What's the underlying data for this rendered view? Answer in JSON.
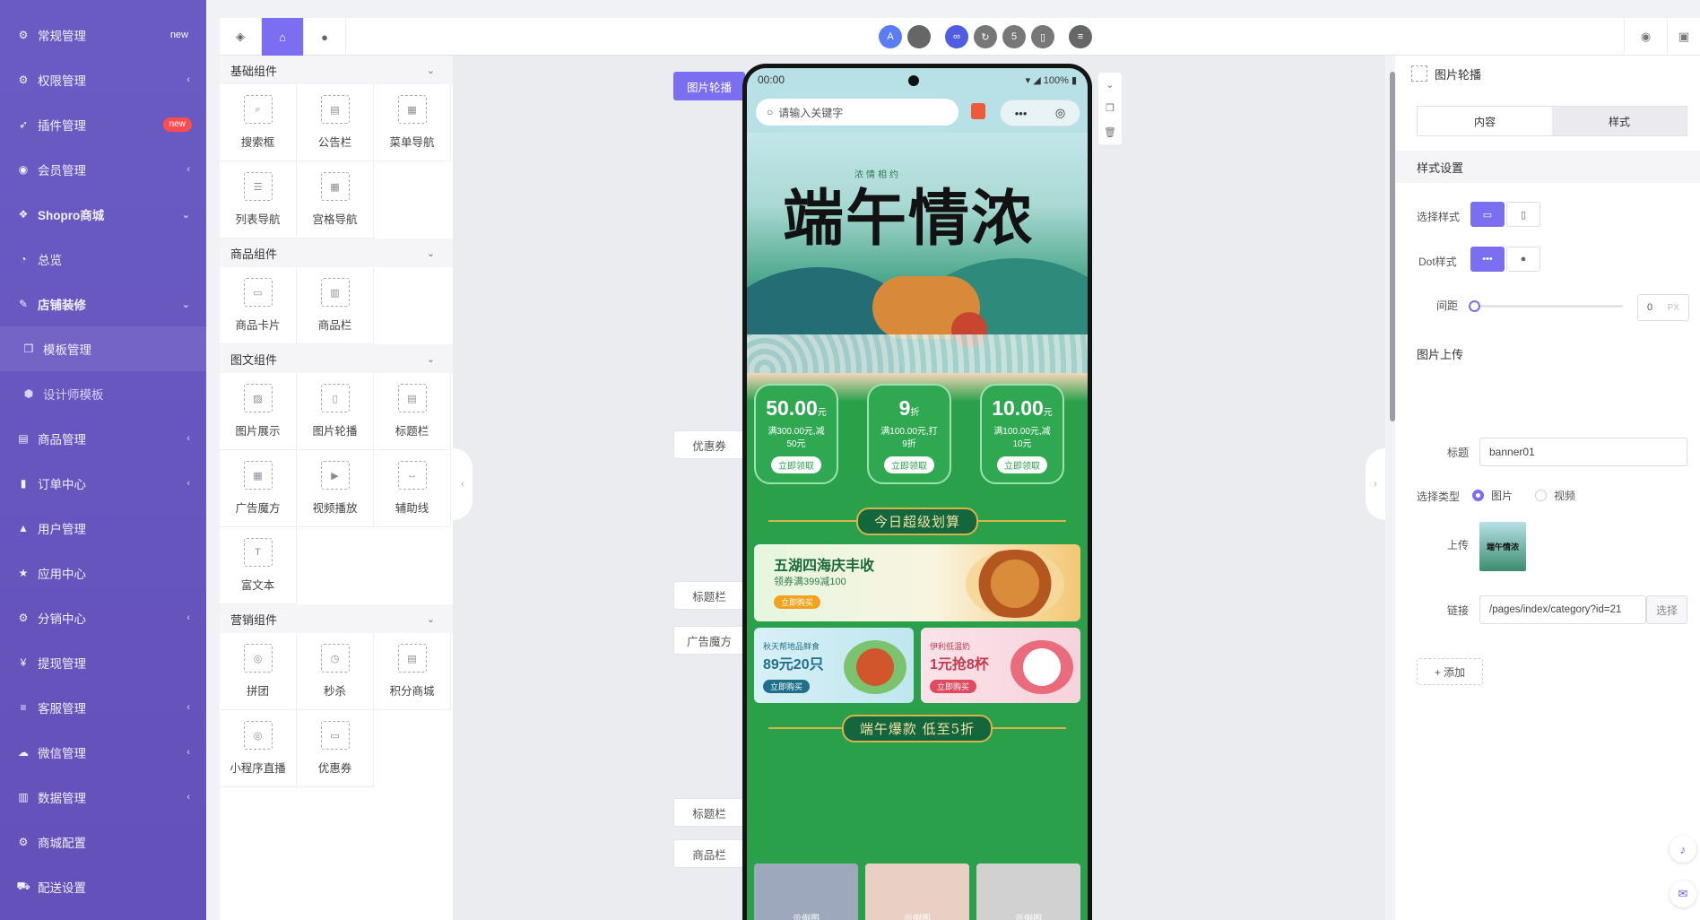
{
  "colors": {
    "accent": "#7b6ef0",
    "nav_bg": "#6451b9",
    "phone_green": "#2aa04a"
  },
  "sidenav": [
    {
      "label": "常规管理",
      "icon": "gear-icon",
      "tag": "new"
    },
    {
      "label": "权限管理",
      "icon": "users-gear-icon",
      "arrow": "‹"
    },
    {
      "label": "插件管理",
      "icon": "rocket-icon",
      "badge": "new"
    },
    {
      "label": "会员管理",
      "icon": "user-circle-icon",
      "arrow": "‹"
    },
    {
      "label": "Shopro商城",
      "icon": "dropbox-icon",
      "arrow": "⌄"
    },
    {
      "label": "总览",
      "icon": "pie-chart-icon"
    },
    {
      "label": "店铺装修",
      "icon": "brush-icon",
      "arrow": "⌄"
    },
    {
      "label": "模板管理",
      "icon": "cubes-icon"
    },
    {
      "label": "设计师模板",
      "icon": "cube-icon"
    },
    {
      "label": "商品管理",
      "icon": "product-icon",
      "arrow": "‹"
    },
    {
      "label": "订单中心",
      "icon": "file-icon",
      "arrow": "‹"
    },
    {
      "label": "用户管理",
      "icon": "user-icon"
    },
    {
      "label": "应用中心",
      "icon": "star-icon"
    },
    {
      "label": "分销中心",
      "icon": "share-users-icon",
      "arrow": "‹"
    },
    {
      "label": "提现管理",
      "icon": "yen-icon"
    },
    {
      "label": "客服管理",
      "icon": "list-icon",
      "arrow": "‹"
    },
    {
      "label": "微信管理",
      "icon": "wechat-icon",
      "arrow": "‹"
    },
    {
      "label": "数据管理",
      "icon": "bar-chart-icon",
      "arrow": "‹"
    },
    {
      "label": "商城配置",
      "icon": "gears-icon"
    },
    {
      "label": "配送设置",
      "icon": "car-icon"
    }
  ],
  "component_panel": {
    "categories": [
      {
        "title": "基础组件",
        "items": [
          "搜索框",
          "公告栏",
          "菜单导航",
          "列表导航",
          "宫格导航"
        ]
      },
      {
        "title": "商品组件",
        "items": [
          "商品卡片",
          "商品栏"
        ]
      },
      {
        "title": "图文组件",
        "items": [
          "图片展示",
          "图片轮播",
          "标题栏",
          "广告魔方",
          "视频播放",
          "辅助线",
          "富文本"
        ]
      },
      {
        "title": "营销组件",
        "items": [
          "拼团",
          "秒杀",
          "积分商城",
          "小程序直播",
          "优惠券"
        ]
      }
    ]
  },
  "canvas_tags": {
    "carousel": "图片轮播",
    "coupon": "优惠券",
    "title1": "标题栏",
    "ad_cube": "广告魔方",
    "title2": "标题栏",
    "goods": "商品栏"
  },
  "phone": {
    "time": "00:00",
    "battery": "100%",
    "search_placeholder": "请输入关键字",
    "banner_title": "端午情浓",
    "banner_sub": "浓情相约",
    "coupons": [
      {
        "amount": "50.00",
        "unit": "元",
        "desc1": "满300.00元,减",
        "desc2": "50元",
        "btn": "立即领取"
      },
      {
        "amount": "9",
        "unit": "折",
        "desc1": "满100.00元,打",
        "desc2": "9折",
        "btn": "立即领取"
      },
      {
        "amount": "10.00",
        "unit": "元",
        "desc1": "满100.00元,减",
        "desc2": "10元",
        "btn": "立即领取"
      }
    ],
    "title1": "今日超级划算",
    "ad_big": {
      "title": "五湖四海庆丰收",
      "sub": "领券满399减100",
      "btn": "立即购买"
    },
    "ad_small": [
      {
        "sub": "秋天帮地品鲜食",
        "title": "89元20只",
        "btn": "立即购买"
      },
      {
        "sub": "伊利低温奶",
        "title": "1元抢8杯",
        "btn": "立即购买"
      }
    ],
    "title2": "端午爆款 低至5折",
    "goods": [
      "示例图",
      "示例图",
      "示例图"
    ]
  },
  "props": {
    "header": "图片轮播",
    "tab_content": "内容",
    "tab_style": "样式",
    "style_section": "样式设置",
    "select_style_label": "选择样式",
    "dot_style_label": "Dot样式",
    "spacing_label": "间距",
    "spacing_value": "0",
    "spacing_unit": "PX",
    "upload_section": "图片上传",
    "title_label": "标题",
    "title_value": "banner01",
    "type_label": "选择类型",
    "type_image": "图片",
    "type_video": "视频",
    "upload_label": "上传",
    "thumb_text": "端午情浓",
    "link_label": "链接",
    "link_value": "/pages/index/category?id=21",
    "link_select": "选择",
    "add_label": "+ 添加"
  }
}
